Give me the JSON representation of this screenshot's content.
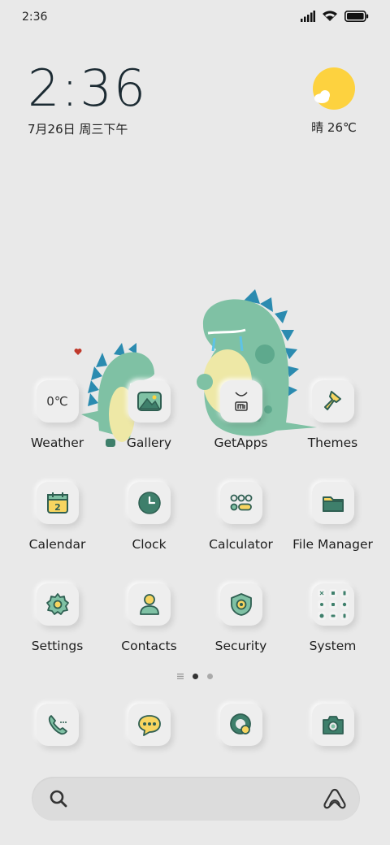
{
  "status_bar": {
    "time": "2:36",
    "icons": [
      "signal-icon",
      "wifi-icon",
      "battery-icon"
    ]
  },
  "clock_widget": {
    "time": "2:36",
    "date": "7月26日 周三下午"
  },
  "weather_widget": {
    "condition_temp": "晴 26℃",
    "icon": "sun-cloud-icon"
  },
  "apps": [
    {
      "label": "Weather",
      "icon": "weather-icon",
      "tile_text": "0℃"
    },
    {
      "label": "Gallery",
      "icon": "gallery-icon"
    },
    {
      "label": "GetApps",
      "icon": "getapps-icon"
    },
    {
      "label": "Themes",
      "icon": "themes-brush-icon"
    },
    {
      "label": "Calendar",
      "icon": "calendar-icon",
      "tile_text": "2"
    },
    {
      "label": "Clock",
      "icon": "clock-icon"
    },
    {
      "label": "Calculator",
      "icon": "calculator-icon"
    },
    {
      "label": "File Manager",
      "icon": "folder-icon"
    },
    {
      "label": "Settings",
      "icon": "settings-gear-icon"
    },
    {
      "label": "Contacts",
      "icon": "contacts-icon"
    },
    {
      "label": "Security",
      "icon": "security-shield-icon"
    },
    {
      "label": "System",
      "icon": "system-folder-icon"
    }
  ],
  "dock": [
    {
      "icon": "phone-icon"
    },
    {
      "icon": "messages-icon"
    },
    {
      "icon": "browser-icon"
    },
    {
      "icon": "camera-icon"
    }
  ],
  "page_indicator": {
    "pages": 3,
    "current": 1
  },
  "search_bar": {
    "left_icon": "search-icon",
    "right_icon": "assistant-icon"
  },
  "colors": {
    "background": "#e9e9e9",
    "icon_green": "#3e7f6b",
    "icon_light_green": "#7fc1a4",
    "accent_yellow": "#f7d560",
    "sun_yellow": "#fdd23f"
  }
}
